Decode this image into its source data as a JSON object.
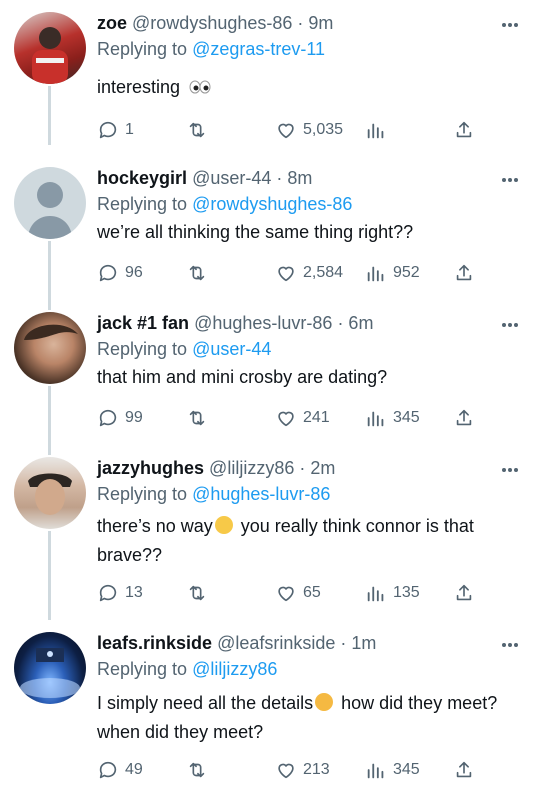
{
  "tweets": [
    {
      "name": "zoe",
      "handle": "@rowdyshughes-86",
      "time": "· 9m",
      "reply_label": "Replying to",
      "reply_to": "@zegras-trev-11",
      "text": "interesting",
      "replies": "1",
      "likes": "5,035",
      "views": ""
    },
    {
      "name": "hockeygirl",
      "handle": "@user-44",
      "time": "· 8m",
      "reply_label": "Replying to",
      "reply_to": "@rowdyshughes-86",
      "text": "we’re all thinking the same thing right??",
      "replies": "96",
      "likes": "2,584",
      "views": "952"
    },
    {
      "name": "jack #1 fan",
      "handle": "@hughes-luvr-86",
      "time": "· 6m",
      "reply_label": "Replying to",
      "reply_to": "@user-44",
      "text": "that him and mini crosby are dating?",
      "replies": "99",
      "likes": "241",
      "views": "345"
    },
    {
      "name": "jazzyhughes",
      "handle": "@liljizzy86",
      "time": "· 2m",
      "reply_label": "Replying to",
      "reply_to": "@hughes-luvr-86",
      "text_a": "there’s no way",
      "text_b": "you really think connor is that brave??",
      "replies": "13",
      "likes": "65",
      "views": "135"
    },
    {
      "name": "leafs.rinkside",
      "handle": "@leafsrinkside",
      "time": "· 1m",
      "reply_label": "Replying to",
      "reply_to": "@liljizzy86",
      "text_a": "I simply need all the details",
      "text_b": "how did they meet? when did they meet?",
      "replies": "49",
      "likes": "213",
      "views": "345"
    }
  ],
  "colors": {
    "link": "#1d9bf0",
    "muted": "#536471",
    "line": "#cfd9de"
  }
}
